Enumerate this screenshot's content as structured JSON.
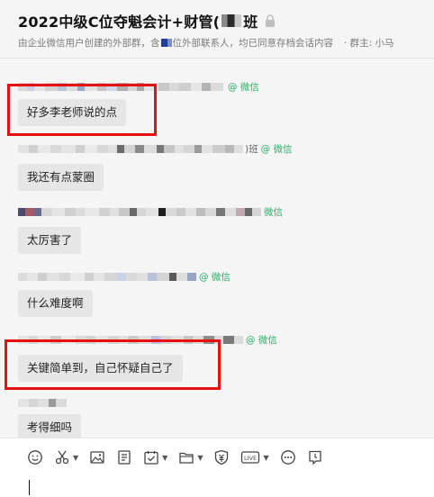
{
  "header": {
    "title": "2022中级C位夺魁会计+财管(",
    "title_suffix": "班",
    "subtitle_before": "由企业微信用户创建的外部群，含",
    "subtitle_after": "位外部联系人，均已同意存档会话内容",
    "owner": "· 群主: 小马"
  },
  "messages": [
    {
      "sender_tail": "",
      "tag": "@ 微信",
      "text": "好多李老师说的点"
    },
    {
      "sender_tail": ")班",
      "tag": "@ 微信",
      "text": "我还有点蒙圈"
    },
    {
      "sender_tail": "",
      "tag": "微信",
      "text": "太厉害了"
    },
    {
      "sender_tail": "",
      "tag": "@ 微信",
      "text": "什么难度啊"
    },
    {
      "sender_tail": "",
      "tag": "@ 微信",
      "text": "关键简单到，自己怀疑自己了"
    },
    {
      "sender_tail": "",
      "tag": "",
      "text": "考得细吗"
    }
  ],
  "colors": {
    "highlight": "#e80f0f",
    "wechat_green": "#2aae67",
    "bubble": "#e6e6e6",
    "chat_bg": "#f5f5f5"
  },
  "toolbar": {
    "icons": [
      "emoji-icon",
      "scissors-icon",
      "image-icon",
      "document-icon",
      "schedule-icon",
      "folder-icon",
      "red-packet-icon",
      "live-icon",
      "more-icon",
      "history-icon"
    ]
  },
  "input": {
    "value": ""
  }
}
